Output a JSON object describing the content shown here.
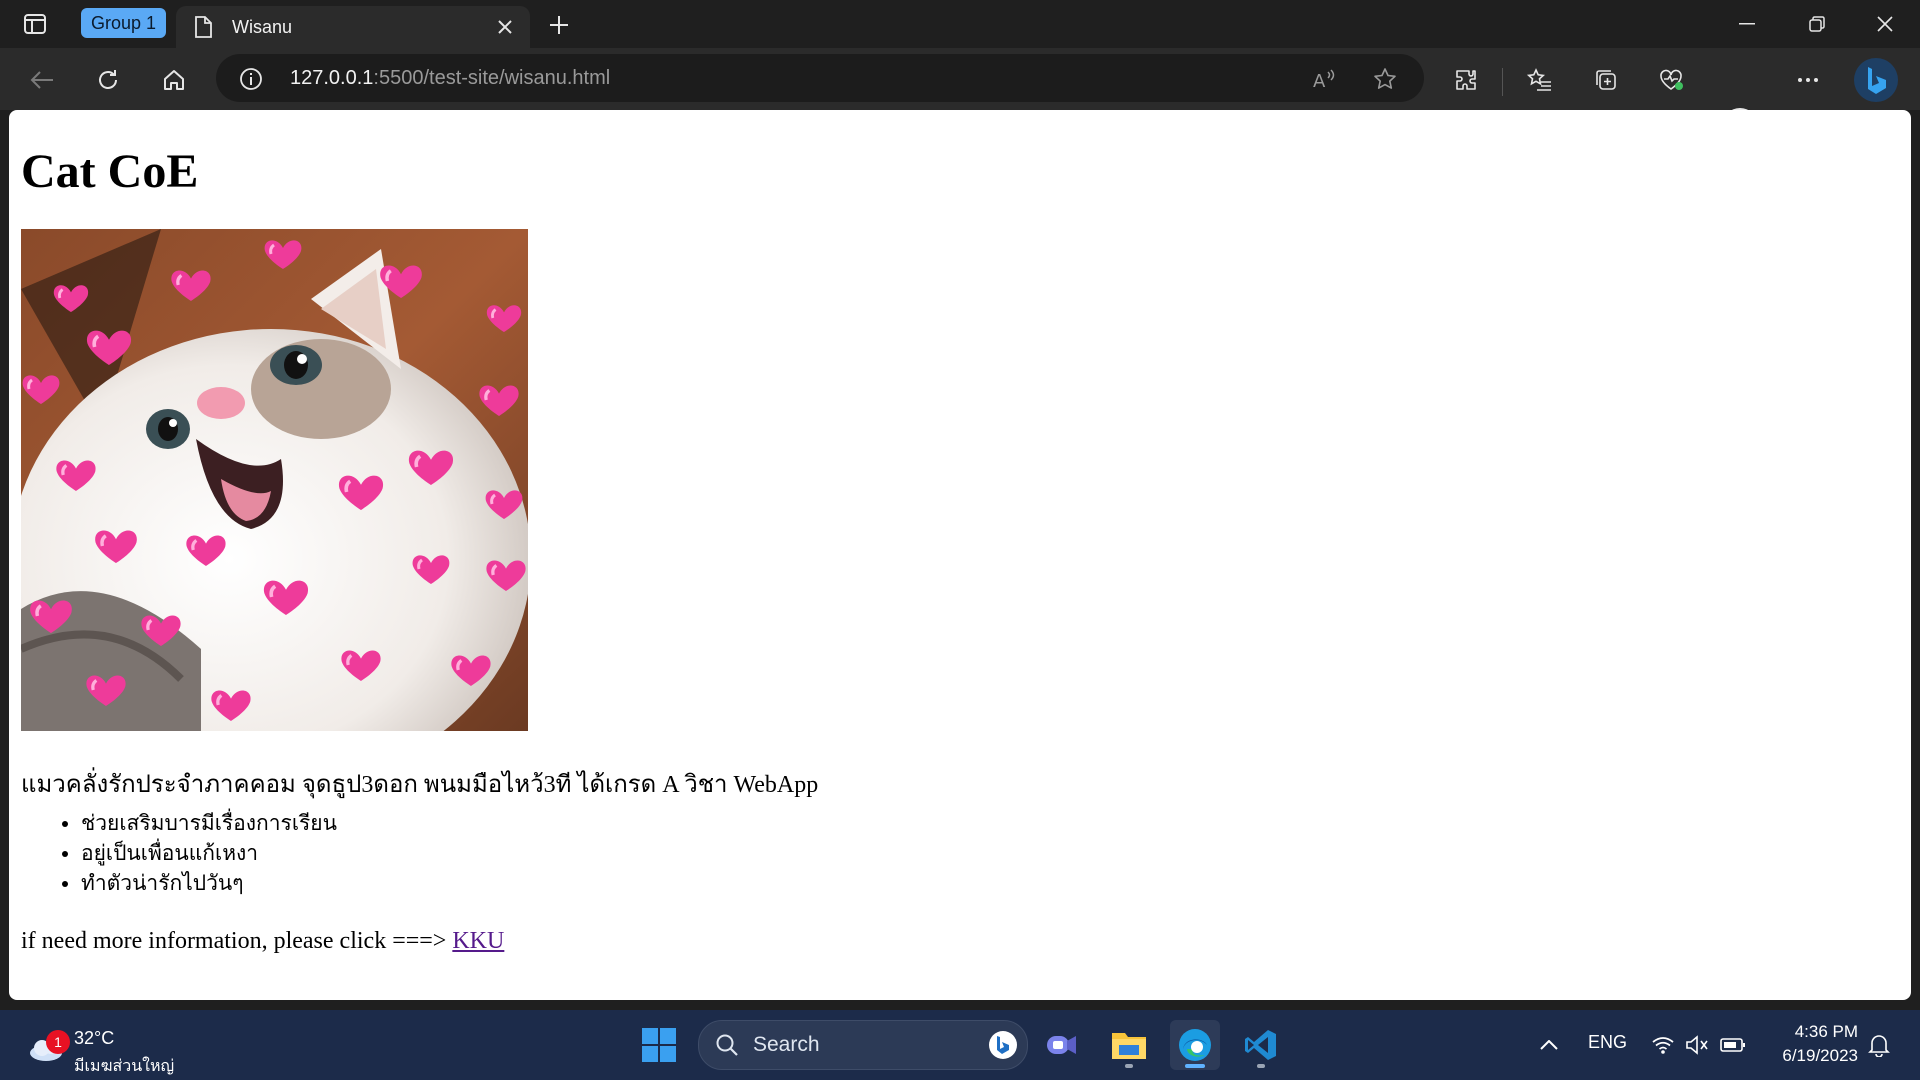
{
  "browser": {
    "tab_group": "Group 1",
    "tab_title": "Wisanu",
    "url_host": "127.0.0.1",
    "url_rest": ":5500/test-site/wisanu.html"
  },
  "page": {
    "heading": "Cat CoE",
    "description": "แมวคลั่งรักประจำภาคคอม จุดธูป3ดอก พนมมือไหว้3ที ได้เกรด A วิชา WebApp",
    "list_items": [
      "ช่วยเสริมบารมีเรื่องการเรียน",
      "อยู่เป็นเพื่อนแก้เหงา",
      "ทำตัวน่ารักไปวันๆ"
    ],
    "more_text": "if need more information, please click ===> ",
    "link_text": "KKU"
  },
  "taskbar": {
    "weather_temp": "32°C",
    "weather_condition": "มีเมฆส่วนใหญ่",
    "weather_badge": "1",
    "search_label": "Search",
    "language": "ENG",
    "time": "4:36 PM",
    "date": "6/19/2023"
  },
  "icons": [
    "sidebar-icon",
    "page-icon",
    "close-icon",
    "plus-icon",
    "minimize-icon",
    "restore-icon",
    "back-icon",
    "refresh-icon",
    "home-icon",
    "info-icon",
    "read-aloud-icon",
    "star-icon",
    "extensions-icon",
    "favorites-icon",
    "collections-icon",
    "browser-essentials-icon",
    "more-icon",
    "bing-icon",
    "windows-icon",
    "teams-icon",
    "file-explorer-icon",
    "edge-icon",
    "vscode-icon",
    "wifi-icon",
    "volume-muted-icon",
    "battery-icon",
    "notification-icon"
  ],
  "colors": {
    "accent": "#5aa9f5",
    "link_visited": "#551a8b",
    "taskbar": "#1c2b4a"
  }
}
